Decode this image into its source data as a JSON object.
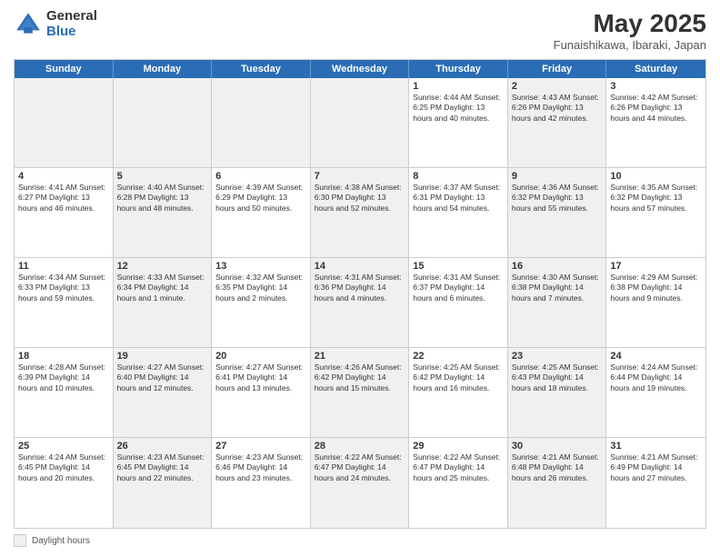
{
  "header": {
    "logo_general": "General",
    "logo_blue": "Blue",
    "title": "May 2025",
    "location": "Funaishikawa, Ibaraki, Japan"
  },
  "days_of_week": [
    "Sunday",
    "Monday",
    "Tuesday",
    "Wednesday",
    "Thursday",
    "Friday",
    "Saturday"
  ],
  "weeks": [
    [
      {
        "day": "",
        "text": "",
        "shaded": true
      },
      {
        "day": "",
        "text": "",
        "shaded": true
      },
      {
        "day": "",
        "text": "",
        "shaded": true
      },
      {
        "day": "",
        "text": "",
        "shaded": true
      },
      {
        "day": "1",
        "text": "Sunrise: 4:44 AM\nSunset: 6:25 PM\nDaylight: 13 hours\nand 40 minutes.",
        "shaded": false
      },
      {
        "day": "2",
        "text": "Sunrise: 4:43 AM\nSunset: 6:26 PM\nDaylight: 13 hours\nand 42 minutes.",
        "shaded": true
      },
      {
        "day": "3",
        "text": "Sunrise: 4:42 AM\nSunset: 6:26 PM\nDaylight: 13 hours\nand 44 minutes.",
        "shaded": false
      }
    ],
    [
      {
        "day": "4",
        "text": "Sunrise: 4:41 AM\nSunset: 6:27 PM\nDaylight: 13 hours\nand 46 minutes.",
        "shaded": false
      },
      {
        "day": "5",
        "text": "Sunrise: 4:40 AM\nSunset: 6:28 PM\nDaylight: 13 hours\nand 48 minutes.",
        "shaded": true
      },
      {
        "day": "6",
        "text": "Sunrise: 4:39 AM\nSunset: 6:29 PM\nDaylight: 13 hours\nand 50 minutes.",
        "shaded": false
      },
      {
        "day": "7",
        "text": "Sunrise: 4:38 AM\nSunset: 6:30 PM\nDaylight: 13 hours\nand 52 minutes.",
        "shaded": true
      },
      {
        "day": "8",
        "text": "Sunrise: 4:37 AM\nSunset: 6:31 PM\nDaylight: 13 hours\nand 54 minutes.",
        "shaded": false
      },
      {
        "day": "9",
        "text": "Sunrise: 4:36 AM\nSunset: 6:32 PM\nDaylight: 13 hours\nand 55 minutes.",
        "shaded": true
      },
      {
        "day": "10",
        "text": "Sunrise: 4:35 AM\nSunset: 6:32 PM\nDaylight: 13 hours\nand 57 minutes.",
        "shaded": false
      }
    ],
    [
      {
        "day": "11",
        "text": "Sunrise: 4:34 AM\nSunset: 6:33 PM\nDaylight: 13 hours\nand 59 minutes.",
        "shaded": false
      },
      {
        "day": "12",
        "text": "Sunrise: 4:33 AM\nSunset: 6:34 PM\nDaylight: 14 hours\nand 1 minute.",
        "shaded": true
      },
      {
        "day": "13",
        "text": "Sunrise: 4:32 AM\nSunset: 6:35 PM\nDaylight: 14 hours\nand 2 minutes.",
        "shaded": false
      },
      {
        "day": "14",
        "text": "Sunrise: 4:31 AM\nSunset: 6:36 PM\nDaylight: 14 hours\nand 4 minutes.",
        "shaded": true
      },
      {
        "day": "15",
        "text": "Sunrise: 4:31 AM\nSunset: 6:37 PM\nDaylight: 14 hours\nand 6 minutes.",
        "shaded": false
      },
      {
        "day": "16",
        "text": "Sunrise: 4:30 AM\nSunset: 6:38 PM\nDaylight: 14 hours\nand 7 minutes.",
        "shaded": true
      },
      {
        "day": "17",
        "text": "Sunrise: 4:29 AM\nSunset: 6:38 PM\nDaylight: 14 hours\nand 9 minutes.",
        "shaded": false
      }
    ],
    [
      {
        "day": "18",
        "text": "Sunrise: 4:28 AM\nSunset: 6:39 PM\nDaylight: 14 hours\nand 10 minutes.",
        "shaded": false
      },
      {
        "day": "19",
        "text": "Sunrise: 4:27 AM\nSunset: 6:40 PM\nDaylight: 14 hours\nand 12 minutes.",
        "shaded": true
      },
      {
        "day": "20",
        "text": "Sunrise: 4:27 AM\nSunset: 6:41 PM\nDaylight: 14 hours\nand 13 minutes.",
        "shaded": false
      },
      {
        "day": "21",
        "text": "Sunrise: 4:26 AM\nSunset: 6:42 PM\nDaylight: 14 hours\nand 15 minutes.",
        "shaded": true
      },
      {
        "day": "22",
        "text": "Sunrise: 4:25 AM\nSunset: 6:42 PM\nDaylight: 14 hours\nand 16 minutes.",
        "shaded": false
      },
      {
        "day": "23",
        "text": "Sunrise: 4:25 AM\nSunset: 6:43 PM\nDaylight: 14 hours\nand 18 minutes.",
        "shaded": true
      },
      {
        "day": "24",
        "text": "Sunrise: 4:24 AM\nSunset: 6:44 PM\nDaylight: 14 hours\nand 19 minutes.",
        "shaded": false
      }
    ],
    [
      {
        "day": "25",
        "text": "Sunrise: 4:24 AM\nSunset: 6:45 PM\nDaylight: 14 hours\nand 20 minutes.",
        "shaded": false
      },
      {
        "day": "26",
        "text": "Sunrise: 4:23 AM\nSunset: 6:45 PM\nDaylight: 14 hours\nand 22 minutes.",
        "shaded": true
      },
      {
        "day": "27",
        "text": "Sunrise: 4:23 AM\nSunset: 6:46 PM\nDaylight: 14 hours\nand 23 minutes.",
        "shaded": false
      },
      {
        "day": "28",
        "text": "Sunrise: 4:22 AM\nSunset: 6:47 PM\nDaylight: 14 hours\nand 24 minutes.",
        "shaded": true
      },
      {
        "day": "29",
        "text": "Sunrise: 4:22 AM\nSunset: 6:47 PM\nDaylight: 14 hours\nand 25 minutes.",
        "shaded": false
      },
      {
        "day": "30",
        "text": "Sunrise: 4:21 AM\nSunset: 6:48 PM\nDaylight: 14 hours\nand 26 minutes.",
        "shaded": true
      },
      {
        "day": "31",
        "text": "Sunrise: 4:21 AM\nSunset: 6:49 PM\nDaylight: 14 hours\nand 27 minutes.",
        "shaded": false
      }
    ]
  ],
  "footer": {
    "shaded_label": "Daylight hours"
  }
}
